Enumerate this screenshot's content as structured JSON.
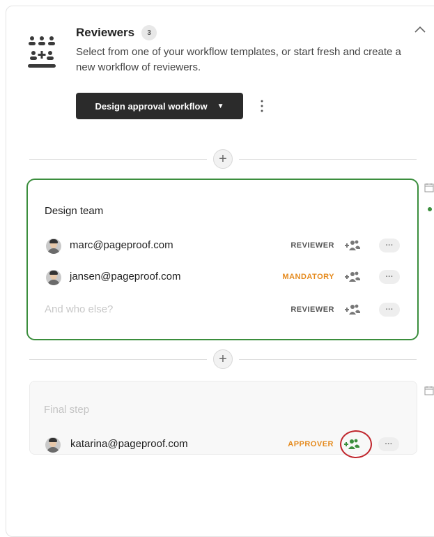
{
  "header": {
    "title": "Reviewers",
    "count": "3",
    "description": "Select from one of your workflow templates, or start fresh and create a new workflow of reviewers.",
    "workflow_button_label": "Design approval workflow",
    "caret_glyph": "▼",
    "collapse_icon": "chevron-up-icon",
    "kebab_icon": "vertical-dots-icon"
  },
  "add_step_glyph": "+",
  "steps": [
    {
      "title": "Design team",
      "reviewers": [
        {
          "email": "marc@pageproof.com",
          "role": "REVIEWER"
        },
        {
          "email": "jansen@pageproof.com",
          "role": "MANDATORY"
        }
      ],
      "add_row": {
        "placeholder": "And who else?",
        "role": "REVIEWER"
      }
    }
  ],
  "final_step": {
    "title": "Final step",
    "reviewer": {
      "email": "katarina@pageproof.com",
      "role": "APPROVER"
    }
  },
  "more_glyph": "···",
  "colors": {
    "accent_green": "#3b8e3d",
    "mandatory_orange": "#e58a1d",
    "highlight_red": "#c0262d",
    "button_dark": "#2b2b2b"
  }
}
